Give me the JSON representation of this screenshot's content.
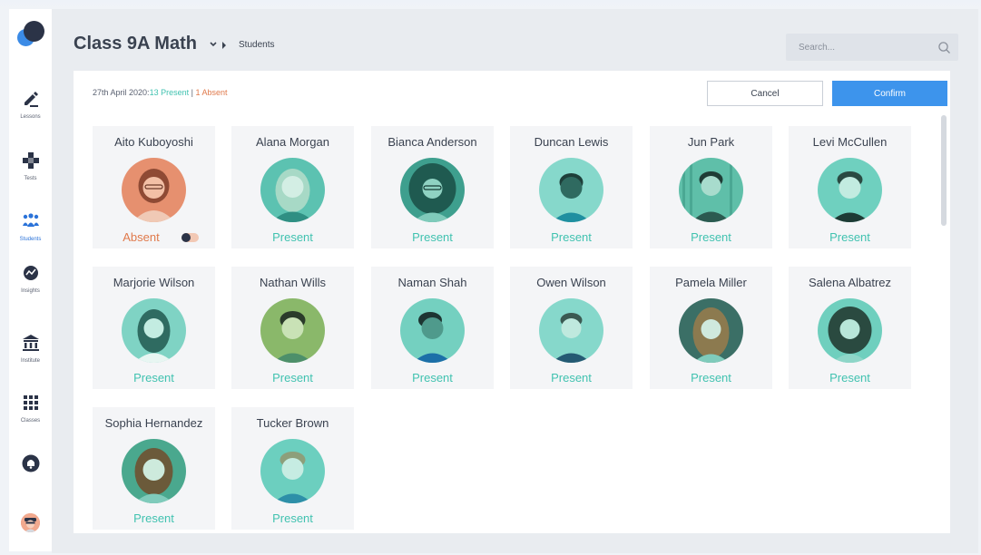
{
  "sidebar": {
    "items": [
      {
        "label": "Lessons",
        "icon": "pencil-icon"
      },
      {
        "label": "Tests",
        "icon": "puzzle-icon"
      },
      {
        "label": "Students",
        "icon": "students-icon",
        "active": true
      },
      {
        "label": "Insights",
        "icon": "insights-icon"
      },
      {
        "label": "Institute",
        "icon": "institute-icon"
      },
      {
        "label": "Classes",
        "icon": "grid-icon"
      }
    ],
    "bell_icon": "bell-icon",
    "avatar_icon": "avatar"
  },
  "header": {
    "title": "Class 9A Math",
    "breadcrumb": "Students"
  },
  "search": {
    "placeholder": "Search..."
  },
  "attendance": {
    "date": "27th April 2020:",
    "present": "13 Present",
    "separator": " | ",
    "absent": "1 Absent"
  },
  "buttons": {
    "cancel": "Cancel",
    "confirm": "Confirm"
  },
  "colors": {
    "present": "#41c2b0",
    "absent": "#e07a4c",
    "accent": "#3d94ec"
  },
  "students": [
    {
      "name": "Aito Kuboyoshi",
      "status": "Absent"
    },
    {
      "name": "Alana Morgan",
      "status": "Present"
    },
    {
      "name": "Bianca Anderson",
      "status": "Present"
    },
    {
      "name": "Duncan Lewis",
      "status": "Present"
    },
    {
      "name": "Jun Park",
      "status": "Present"
    },
    {
      "name": "Levi McCullen",
      "status": "Present"
    },
    {
      "name": "Marjorie Wilson",
      "status": "Present"
    },
    {
      "name": "Nathan Wills",
      "status": "Present"
    },
    {
      "name": "Naman Shah",
      "status": "Present"
    },
    {
      "name": "Owen Wilson",
      "status": "Present"
    },
    {
      "name": "Pamela Miller",
      "status": "Present"
    },
    {
      "name": "Salena Albatrez",
      "status": "Present"
    },
    {
      "name": "Sophia Hernandez",
      "status": "Present"
    },
    {
      "name": "Tucker Brown",
      "status": "Present"
    }
  ]
}
